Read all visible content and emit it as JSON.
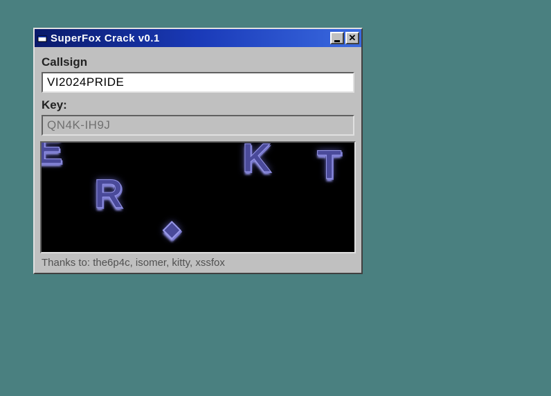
{
  "window": {
    "title": "SuperFox Crack v0.1"
  },
  "form": {
    "callsign_label": "Callsign",
    "callsign_value": "VI2024PRIDE",
    "key_label": "Key:",
    "key_value": "QN4K-IH9J"
  },
  "credits": "Thanks to: the6p4c, isomer, kitty, xssfox",
  "demo_letters": [
    "E",
    "R",
    "K",
    "T"
  ]
}
